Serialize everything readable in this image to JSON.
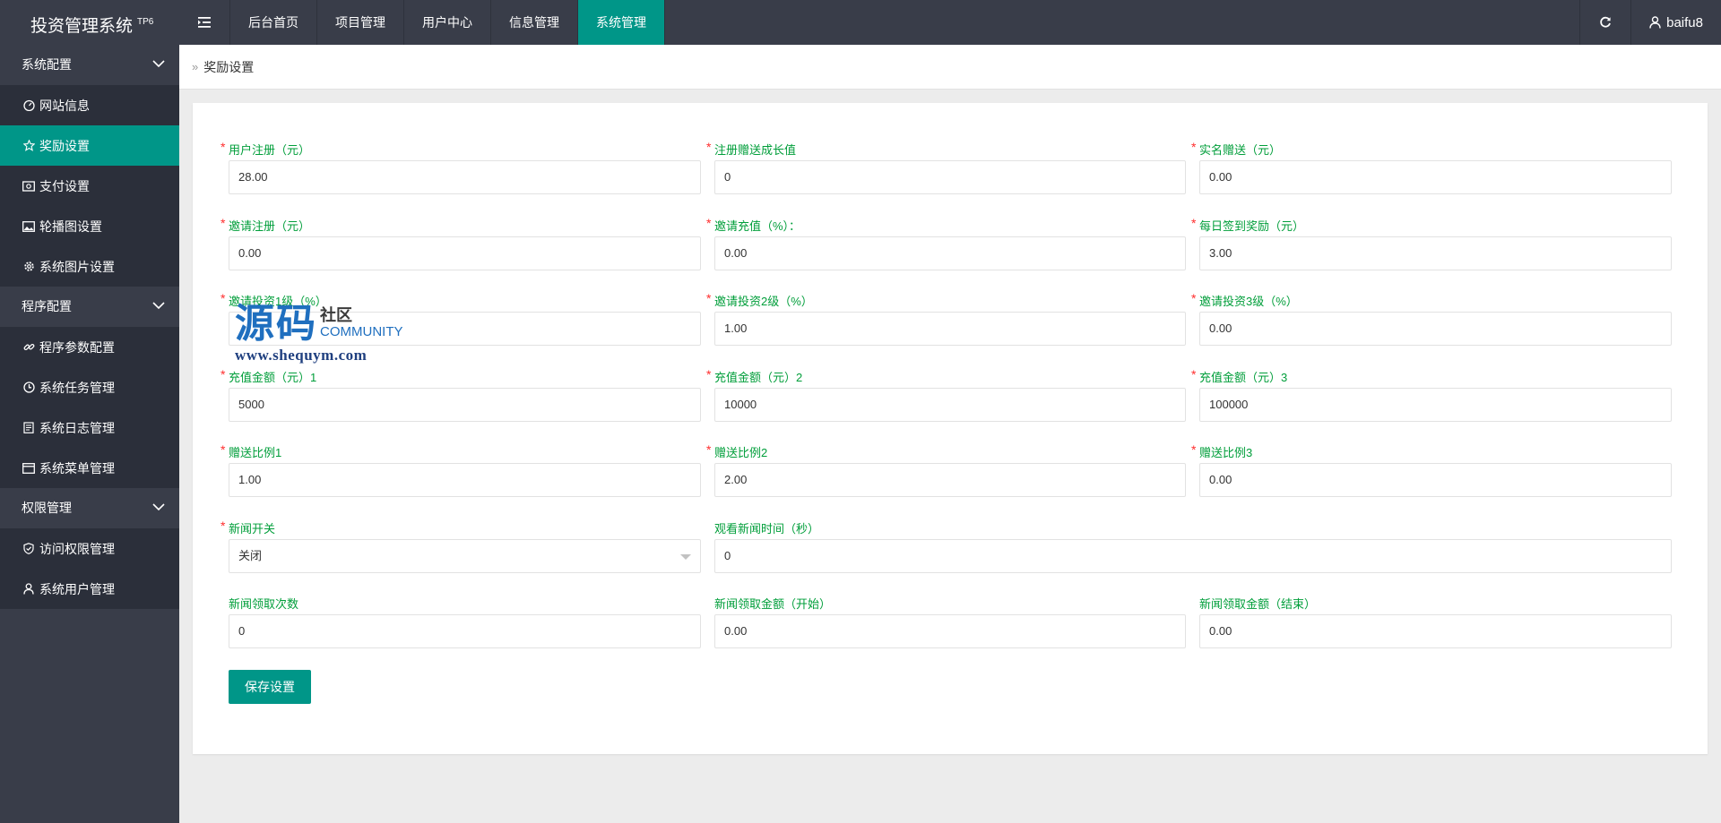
{
  "app": {
    "title": "投资管理系统",
    "badge": "TP6"
  },
  "top_nav": {
    "items": [
      "后台首页",
      "项目管理",
      "用户中心",
      "信息管理",
      "系统管理"
    ],
    "active": "系统管理",
    "username": "baifu8"
  },
  "sidebar": {
    "groups": [
      {
        "label": "系统配置",
        "items": [
          "网站信息",
          "奖励设置",
          "支付设置",
          "轮播图设置",
          "系统图片设置"
        ]
      },
      {
        "label": "程序配置",
        "items": [
          "程序参数配置",
          "系统任务管理",
          "系统日志管理",
          "系统菜单管理"
        ]
      },
      {
        "label": "权限管理",
        "items": [
          "访问权限管理",
          "系统用户管理"
        ]
      }
    ],
    "active_item": "奖励设置"
  },
  "breadcrumb": {
    "label": "奖励设置"
  },
  "form": {
    "fields": [
      {
        "label": "用户注册（元）",
        "value": "28.00",
        "required": true
      },
      {
        "label": "注册赠送成长值",
        "value": "0",
        "required": true
      },
      {
        "label": "实名赠送（元）",
        "value": "0.00",
        "required": true
      },
      {
        "label": "邀请注册（元）",
        "value": "0.00",
        "required": true
      },
      {
        "label": "邀请充值（%）：",
        "value": "0.00",
        "required": true
      },
      {
        "label": "每日签到奖励（元）",
        "value": "3.00",
        "required": true
      },
      {
        "label": "邀请投资1级（%）",
        "value": "",
        "required": true
      },
      {
        "label": "邀请投资2级（%）",
        "value": "1.00",
        "required": true
      },
      {
        "label": "邀请投资3级（%）",
        "value": "0.00",
        "required": true
      },
      {
        "label": "充值金额（元）1",
        "value": "5000",
        "required": true
      },
      {
        "label": "充值金额（元）2",
        "value": "10000",
        "required": true
      },
      {
        "label": "充值金额（元）3",
        "value": "100000",
        "required": true
      },
      {
        "label": "赠送比例1",
        "value": "1.00",
        "required": true
      },
      {
        "label": "赠送比例2",
        "value": "2.00",
        "required": true
      },
      {
        "label": "赠送比例3",
        "value": "0.00",
        "required": true
      },
      {
        "label": "新闻开关",
        "value": "关闭",
        "required": true
      },
      {
        "label": "观看新闻时间（秒）",
        "value": "0",
        "required": false
      },
      {
        "label": "新闻领取次数",
        "value": "0",
        "required": false
      },
      {
        "label": "新闻领取金额（开始）",
        "value": "0.00",
        "required": false
      },
      {
        "label": "新闻领取金额（结束）",
        "value": "0.00",
        "required": false
      }
    ],
    "save_label": "保存设置"
  },
  "watermark": {
    "big": "源码",
    "small": "社区",
    "community": "COMMUNITY",
    "url": "www.shequym.com"
  },
  "colors": {
    "topbar": "#393d49",
    "sidebar_item": "#2b2f3a",
    "accent": "#009688",
    "label": "#009e3a",
    "required": "#ff2d2d"
  }
}
